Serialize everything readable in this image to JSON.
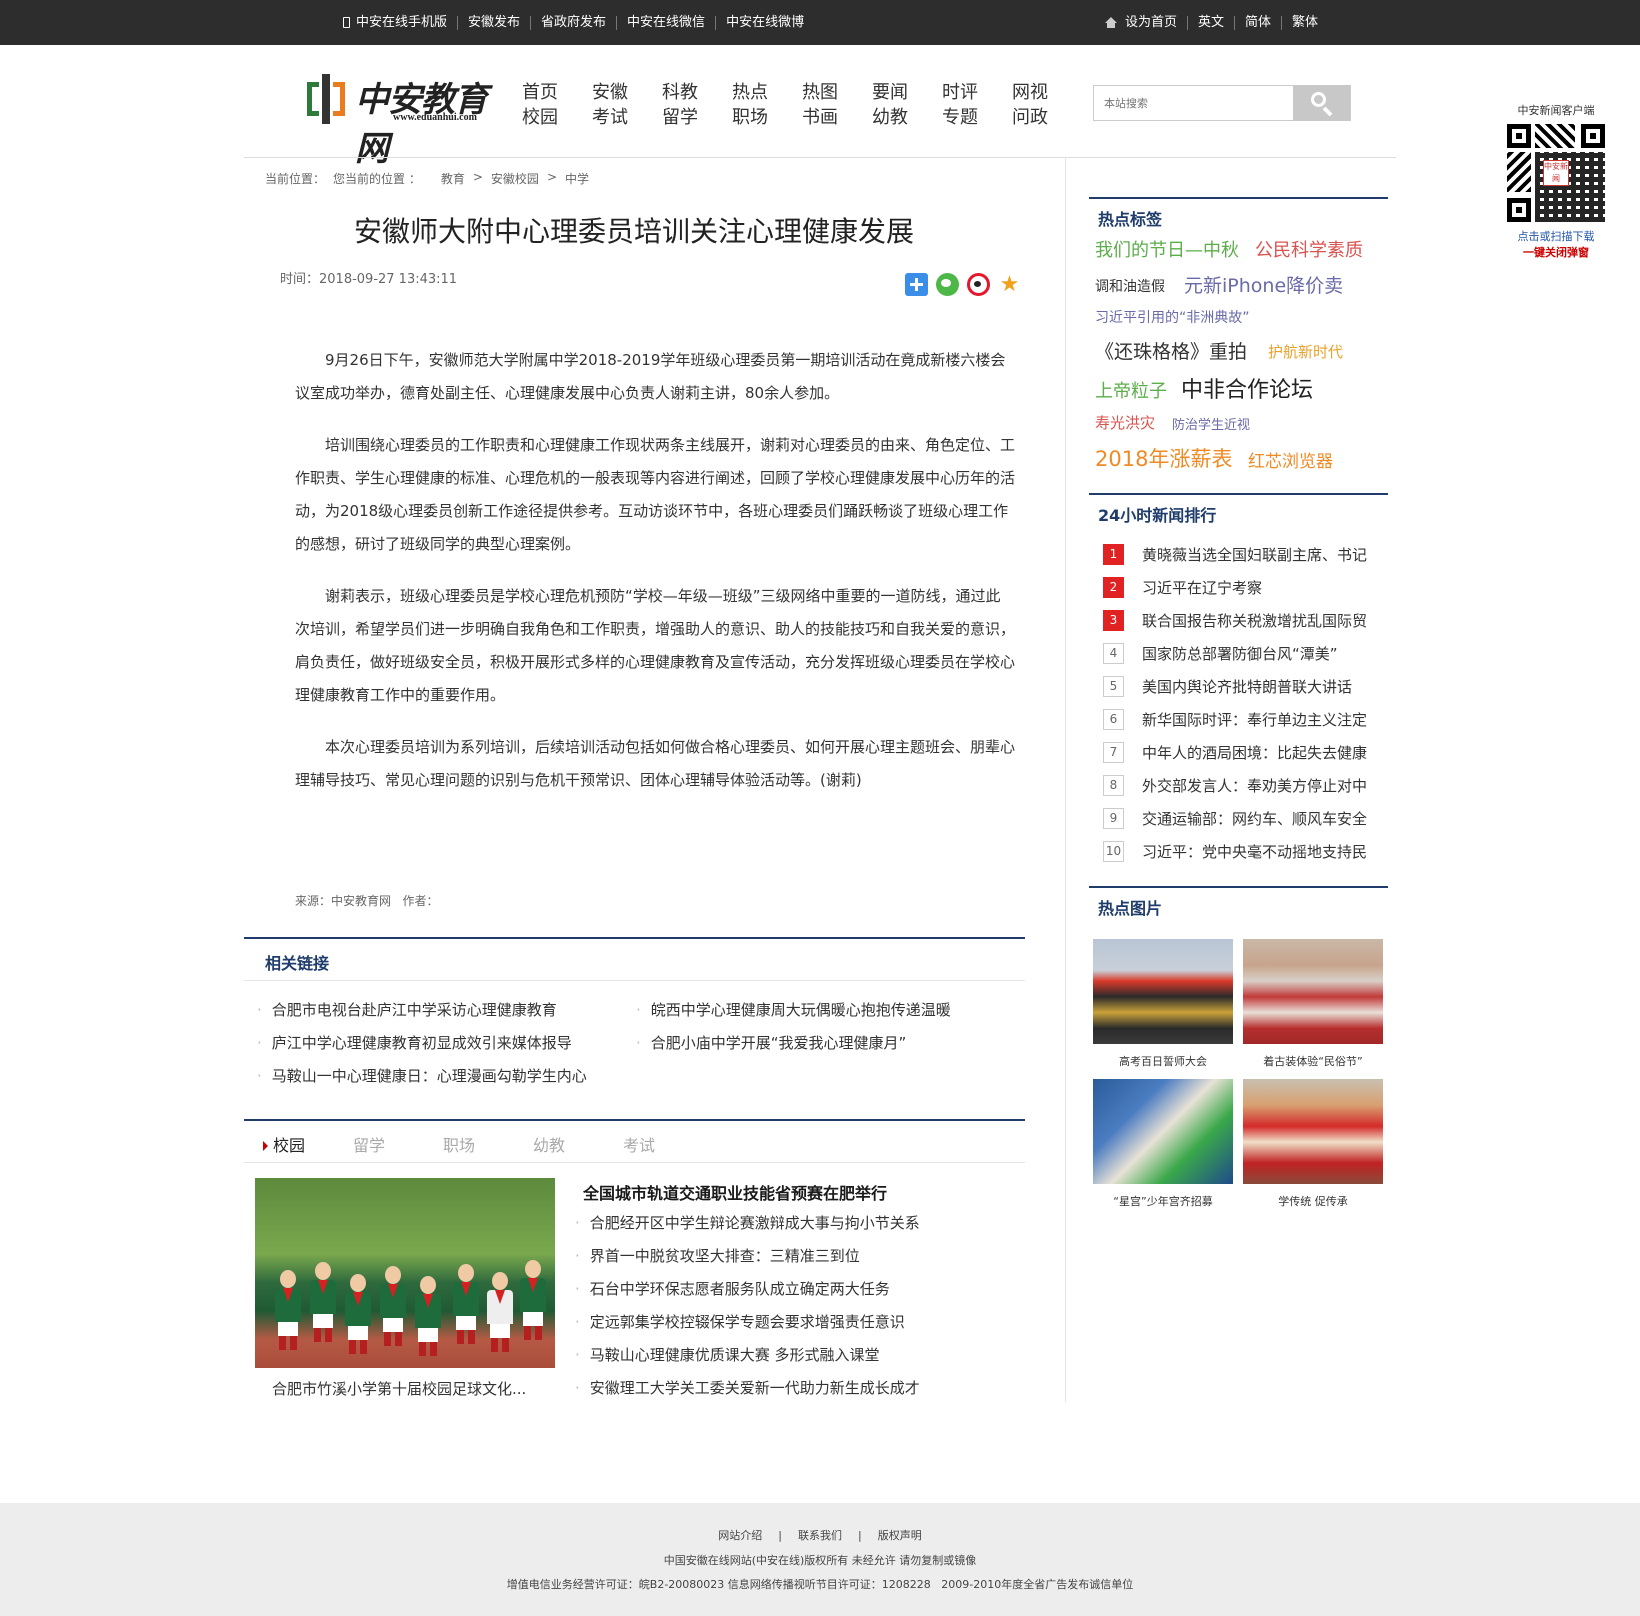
{
  "topbar": {
    "left_links": [
      "中安在线手机版",
      "安徽发布",
      "省政府发布",
      "中安在线微信",
      "中安在线微博"
    ],
    "right_links": [
      "设为首页",
      "英文",
      "简体",
      "繁体"
    ]
  },
  "logo": {
    "name": "中安教育网",
    "url": "www.eduanhui.com"
  },
  "nav": [
    [
      "首页",
      "校园"
    ],
    [
      "安徽",
      "考试"
    ],
    [
      "科教",
      "留学"
    ],
    [
      "热点",
      "职场"
    ],
    [
      "热图",
      "书画"
    ],
    [
      "要闻",
      "幼教"
    ],
    [
      "时评",
      "专题"
    ],
    [
      "网视",
      "问政"
    ]
  ],
  "search": {
    "placeholder": "本站搜索"
  },
  "qr": {
    "title": "中安新闻客户端",
    "center": "中安新闻",
    "link1": "点击或扫描下载",
    "link2": "一键关闭弹窗"
  },
  "breadcrumb": [
    "当前位置：",
    "您当前的位置 ：",
    "教育",
    ">",
    "安徽校园",
    ">",
    "中学"
  ],
  "article": {
    "title": "安徽师大附中心理委员培训关注心理健康发展",
    "time": "时间：2018-09-27 13:43:11",
    "paragraphs": [
      "9月26日下午，安徽师范大学附属中学2018-2019学年班级心理委员第一期培训活动在竟成新楼六楼会议室成功举办，德育处副主任、心理健康发展中心负责人谢莉主讲，80余人参加。",
      "培训围绕心理委员的工作职责和心理健康工作现状两条主线展开，谢莉对心理委员的由来、角色定位、工作职责、学生心理健康的标准、心理危机的一般表现等内容进行阐述，回顾了学校心理健康发展中心历年的活动，为2018级心理委员创新工作途径提供参考。互动访谈环节中，各班心理委员们踊跃畅谈了班级心理工作的感想，研讨了班级同学的典型心理案例。",
      "谢莉表示，班级心理委员是学校心理危机预防“学校—年级—班级”三级网络中重要的一道防线，通过此次培训，希望学员们进一步明确自我角色和工作职责，增强助人的意识、助人的技能技巧和自我关爱的意识，肩负责任，做好班级安全员，积极开展形式多样的心理健康教育及宣传活动，充分发挥班级心理委员在学校心理健康教育工作中的重要作用。",
      "本次心理委员培训为系列培训，后续培训活动包括如何做合格心理委员、如何开展心理主题班会、朋辈心理辅导技巧、常见心理问题的识别与危机干预常识、团体心理辅导体验活动等。(谢莉)"
    ],
    "source": "来源：中安教育网   作者："
  },
  "related": {
    "title": "相关链接",
    "links": [
      "合肥市电视台赴庐江中学采访心理健康教育",
      "皖西中学心理健康周大玩偶暖心抱抱传递温暖",
      "庐江中学心理健康教育初显成效引来媒体报导",
      "合肥小庙中学开展“我爱我心理健康月”",
      "马鞍山一中心理健康日：心理漫画勾勒学生内心"
    ]
  },
  "tabs": [
    "校园",
    "留学",
    "职场",
    "幼教",
    "考试"
  ],
  "campus": {
    "caption": "合肥市竹溪小学第十届校园足球文化...",
    "headline": "全国城市轨道交通职业技能省预赛在肥举行",
    "news": [
      "合肥经开区中学生辩论赛激辩成大事与拘小节关系",
      "界首一中脱贫攻坚大排查：三精准三到位",
      "石台中学环保志愿者服务队成立确定两大任务",
      "定远郭集学校控辍保学专题会要求增强责任意识",
      "马鞍山心理健康优质课大赛 多形式融入课堂",
      "安徽理工大学关工委关爱新一代助力新生成长成才"
    ]
  },
  "sidebar": {
    "tags_title": "热点标签",
    "tags": [
      {
        "text": "我们的节日—中秋",
        "color": "#5cae4a"
      },
      {
        "text": "公民科学素质",
        "color": "#d9534f"
      },
      {
        "text": "调和油造假",
        "color": "#333333"
      },
      {
        "text": "元新iPhone降价卖",
        "color": "#6a6aa8"
      },
      {
        "text": "习近平引用的“非洲典故”",
        "color": "#6a6aa8"
      },
      {
        "text": "《还珠格格》重拍",
        "color": "#333333"
      },
      {
        "text": "护航新时代",
        "color": "#e8a22a"
      },
      {
        "text": "上帝粒子",
        "color": "#5cae4a"
      },
      {
        "text": "中非合作论坛",
        "color": "#222222"
      },
      {
        "text": "寿光洪灾",
        "color": "#d9534f"
      },
      {
        "text": "防治学生近视",
        "color": "#6a6aa8"
      },
      {
        "text": "2018年涨薪表",
        "color": "#f08a24"
      },
      {
        "text": "红芯浏览器",
        "color": "#f08a24"
      }
    ],
    "rank_title": "24小时新闻排行",
    "rank": [
      "黄晓薇当选全国妇联副主席、书记",
      "习近平在辽宁考察",
      "联合国报告称关税激增扰乱国际贸",
      "国家防总部署防御台风“潭美”",
      "美国内舆论齐批特朗普联大讲话",
      "新华国际时评：奉行单边主义注定",
      "中年人的酒局困境：比起失去健康",
      "外交部发言人：奉劝美方停止对中",
      "交通运输部：网约车、顺风车安全",
      "习近平：党中央毫不动摇地支持民"
    ],
    "pics_title": "热点图片",
    "pics": [
      "高考百日誓师大会",
      "着古装体验“民俗节”",
      "“星宫”少年宫齐招募",
      "学传统 促传承"
    ]
  },
  "footer": {
    "links": [
      "网站介绍",
      "|",
      "联系我们",
      "|",
      "版权声明"
    ],
    "line2": "中国安徽在线网站(中安在线)版权所有 未经允许 请勿复制或镜像",
    "line3": "增值电信业务经营许可证：皖B2-20080023 信息网络传播视听节目许可证：1208228   2009-2010年度全省广告发布诚信单位"
  }
}
